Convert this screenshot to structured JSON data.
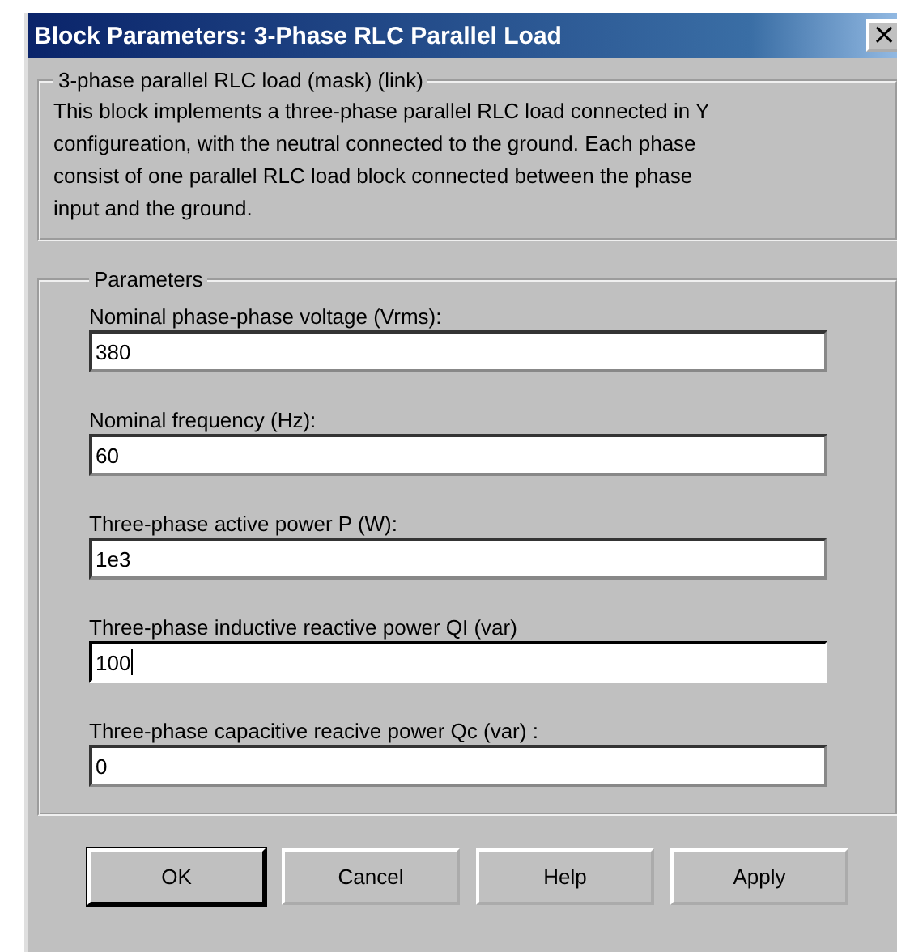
{
  "window": {
    "title": "Block Parameters: 3-Phase RLC Parallel Load",
    "close": "×"
  },
  "description": {
    "title": "3-phase parallel RLC load  (mask) (link)",
    "text": "This block implements a three-phase parallel RLC load connected in Y configureation, with the neutral connected to the ground. Each phase consist of one parallel RLC load block connected between the phase input and the ground."
  },
  "parameters": {
    "title": "Parameters",
    "fields": [
      {
        "label": "Nominal phase-phase voltage (Vrms):",
        "value": "380",
        "focused": false
      },
      {
        "label": "Nominal frequency (Hz):",
        "value": "60",
        "focused": false
      },
      {
        "label": "Three-phase active power P (W):",
        "value": "1e3",
        "focused": false
      },
      {
        "label": "Three-phase inductive reactive power QI (var)",
        "value": "100",
        "focused": true
      },
      {
        "label": "Three-phase capacitive reacive power Qc (var) :",
        "value": "0",
        "focused": false
      }
    ]
  },
  "buttons": [
    {
      "label": "OK",
      "default": true
    },
    {
      "label": "Cancel",
      "default": false
    },
    {
      "label": "Help",
      "default": false
    },
    {
      "label": "Apply",
      "default": false
    }
  ]
}
